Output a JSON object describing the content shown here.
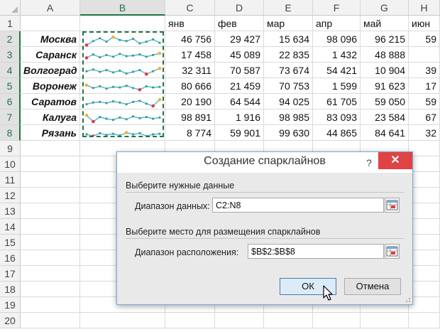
{
  "columns": [
    "A",
    "B",
    "C",
    "D",
    "E",
    "F",
    "G",
    "H"
  ],
  "rows": [
    "1",
    "2",
    "3",
    "4",
    "5",
    "6",
    "7",
    "8",
    "9",
    "10",
    "11",
    "12",
    "13",
    "14",
    "15",
    "16",
    "17",
    "18",
    "19",
    "20"
  ],
  "months": [
    "янв",
    "фев",
    "мар",
    "апр",
    "май",
    "июн"
  ],
  "cities": [
    "Москва",
    "Саранск",
    "Волгоград",
    "Воронеж",
    "Саратов",
    "Калуга",
    "Рязань"
  ],
  "data": [
    [
      "46 756",
      "29 427",
      "15 634",
      "98 096",
      "96 215",
      "59"
    ],
    [
      "17 458",
      "45 089",
      "22 835",
      "1 432",
      "48 888",
      ""
    ],
    [
      "32 311",
      "70 587",
      "73 674",
      "54 421",
      "10 904",
      "39"
    ],
    [
      "80 666",
      "21 459",
      "70 753",
      "1 599",
      "91 623",
      "17"
    ],
    [
      "20 190",
      "64 544",
      "94 025",
      "61 705",
      "59 050",
      "59"
    ],
    [
      "98 891",
      "1 916",
      "98 985",
      "83 093",
      "23 584",
      "67"
    ],
    [
      "8 774",
      "59 901",
      "99 630",
      "44 865",
      "84 641",
      "32"
    ]
  ],
  "colors": {
    "accent": "#217346",
    "sparkline": "#4aa7d8",
    "marker": "#2aa57a",
    "high": "#f0b429",
    "low": "#e03b3b",
    "close": "#e04343"
  },
  "dialog": {
    "title": "Создание спарклайнов",
    "help": "?",
    "close": "✕",
    "section1": "Выберите нужные данные",
    "data_range_label": "Диапазон данных:",
    "data_range_value": "C2:N8",
    "section2": "Выберите место для размещения спарклайнов",
    "location_label": "Диапазон расположения:",
    "location_value": "$B$2:$B$8",
    "ok": "ОК",
    "cancel": "Отмена"
  },
  "icons": {
    "ref_button": "collapse-dialog-icon",
    "cursor": "mouse-pointer-icon"
  }
}
